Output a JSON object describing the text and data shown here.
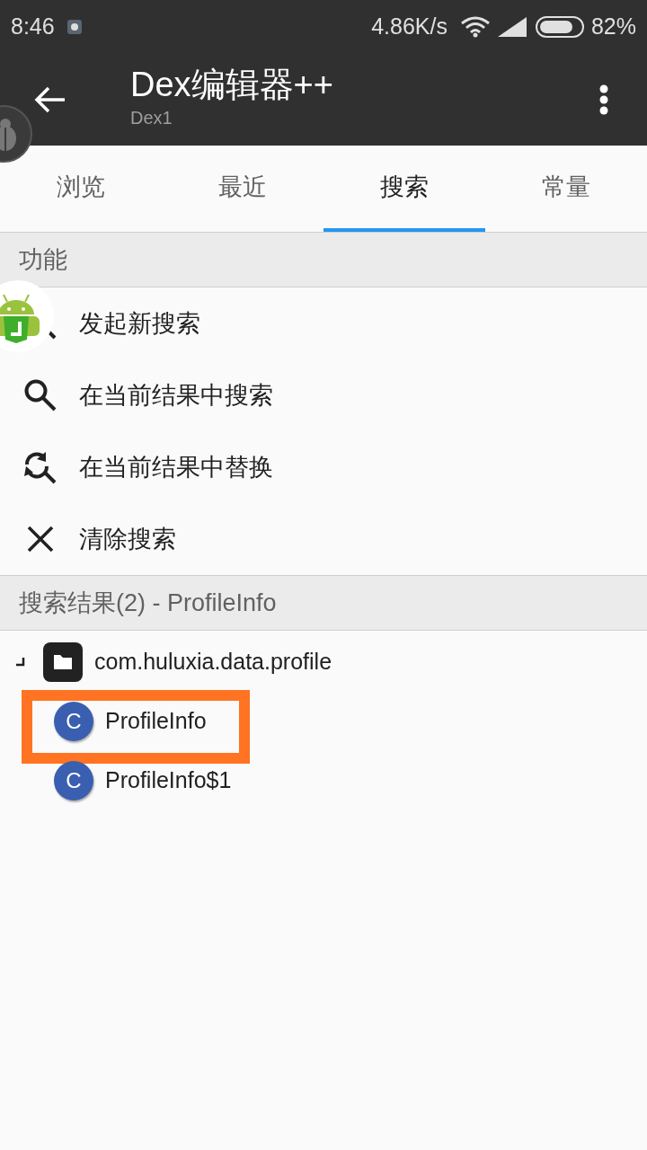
{
  "status_bar": {
    "time": "8:46",
    "speed": "4.86K/s",
    "battery": "82%"
  },
  "app_bar": {
    "title": "Dex编辑器++",
    "subtitle": "Dex1"
  },
  "tabs": [
    {
      "label": "浏览",
      "selected": false
    },
    {
      "label": "最近",
      "selected": false
    },
    {
      "label": "搜索",
      "selected": true
    },
    {
      "label": "常量",
      "selected": false
    }
  ],
  "functions": {
    "header": "功能",
    "items": [
      {
        "label": "发起新搜索",
        "kind": "search"
      },
      {
        "label": "在当前结果中搜索",
        "kind": "search"
      },
      {
        "label": "在当前结果中替换",
        "kind": "replace"
      },
      {
        "label": "清除搜索",
        "kind": "clear"
      }
    ]
  },
  "results": {
    "header": "搜索结果(2) - ProfileInfo",
    "tree": [
      {
        "label": "com.huluxia.data.profile",
        "kind": "package",
        "expanded": true,
        "children": [
          {
            "label": "ProfileInfo",
            "kind": "class",
            "badge": "C",
            "highlighted": true
          },
          {
            "label": "ProfileInfo$1",
            "kind": "class",
            "badge": "C",
            "highlighted": false
          }
        ]
      }
    ]
  }
}
